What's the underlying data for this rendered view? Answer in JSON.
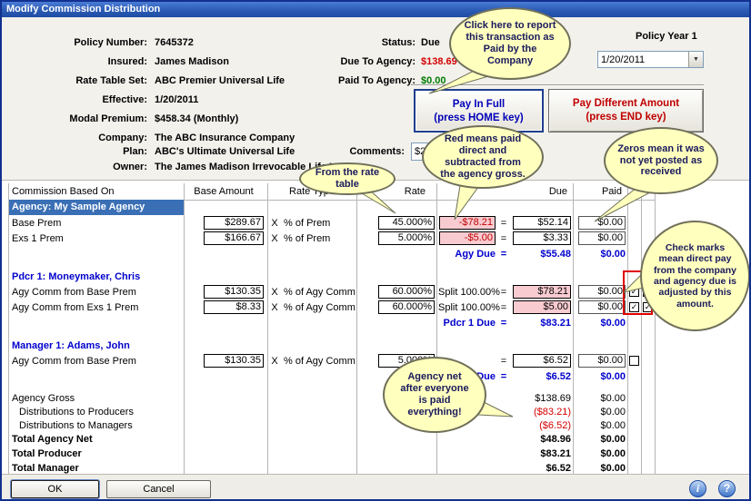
{
  "window": {
    "title": "Modify Commission Distribution"
  },
  "icons": {
    "check": "✓",
    "dropdown": "▼",
    "info": "i",
    "help": "?"
  },
  "colors": {
    "due_red": "#D40000",
    "paid_green": "#007A00",
    "sum_blue": "#0000CC",
    "pink": "#F8CBD0",
    "agency_row_blue": "#3A6FB5",
    "highlight_red": "#E00000"
  },
  "header": {
    "fields": [
      {
        "label": "Policy Number:",
        "value": "7645372"
      },
      {
        "label": "Insured:",
        "value": "James Madison"
      },
      {
        "label": "Rate Table Set:",
        "value": "ABC Premier Universal Life"
      },
      {
        "label": "Effective:",
        "value": "1/20/2011"
      },
      {
        "label": "Modal Premium:",
        "value": "$458.34 (Monthly)"
      },
      {
        "label": "Company:",
        "value": "The ABC Insurance Company"
      },
      {
        "label": "Plan:",
        "value": "ABC's Ultimate Universal Life"
      },
      {
        "label": "Owner:",
        "value": "The James Madison Irrevocable Life Ins"
      }
    ],
    "status": {
      "label": "Status:",
      "value": "Due"
    },
    "due_to_agency": {
      "label": "Due To Agency:",
      "value": "$138.69"
    },
    "paid_to_agency": {
      "label": "Paid To Agency:",
      "value": "$0.00"
    },
    "policy_year": "Policy Year 1",
    "date_value": "1/20/2011",
    "comments": {
      "label": "Comments:",
      "value": "$2"
    },
    "buttons": {
      "pay_in_full": {
        "line1": "Pay In Full",
        "line2": "(press HOME key)"
      },
      "pay_different": {
        "line1": "Pay Different Amount",
        "line2": "(press END key)"
      }
    }
  },
  "table": {
    "headers": {
      "based_on": "Commission Based On",
      "base_amount": "Base Amount",
      "rate_type": "Rate Type",
      "rate": "Rate",
      "due": "Due",
      "paid": "Paid"
    },
    "x_label": "X",
    "eq_label": "=",
    "agency": {
      "title": "Agency: My Sample Agency",
      "rows": [
        {
          "label": "Base Prem",
          "base": "$289.67",
          "rtype": "% of Prem",
          "rate": "45.000%",
          "adj": "-$78.21",
          "due": "$52.14",
          "paid": "$0.00"
        },
        {
          "label": "Exs 1 Prem",
          "base": "$166.67",
          "rtype": "% of Prem",
          "rate": "5.000%",
          "adj": "-$5.00",
          "due": "$3.33",
          "paid": "$0.00"
        }
      ],
      "due_label": "Agy Due",
      "due": "$55.48",
      "paid": "$0.00"
    },
    "producer": {
      "title": "Pdcr 1: Moneymaker, Chris",
      "rows": [
        {
          "label": "Agy Comm from Base Prem",
          "base": "$130.35",
          "rtype": "% of Agy Comm",
          "rate": "60.000%",
          "split": "Split 100.00%",
          "due": "$78.21",
          "paid": "$0.00"
        },
        {
          "label": "Agy Comm from Exs 1 Prem",
          "base": "$8.33",
          "rtype": "% of Agy Comm",
          "rate": "60.000%",
          "split": "Split 100.00%",
          "due": "$5.00",
          "paid": "$0.00"
        }
      ],
      "due_label": "Pdcr 1 Due",
      "due": "$83.21",
      "paid": "$0.00"
    },
    "manager": {
      "title": "Manager 1: Adams, John",
      "rows": [
        {
          "label": "Agy Comm from Base Prem",
          "base": "$130.35",
          "rtype": "% of Agy Comm",
          "rate": "5.000%",
          "due": "$6.52",
          "paid": "$0.00"
        }
      ],
      "due_label": "Mgr 1 Due",
      "due": "$6.52",
      "paid": "$0.00"
    },
    "summary": [
      {
        "label": "Agency Gross",
        "due": "$138.69",
        "paid": "$0.00"
      },
      {
        "label": "Distributions to Producers",
        "due": "($83.21)",
        "paid": "$0.00"
      },
      {
        "label": "Distributions to Managers",
        "due": "($6.52)",
        "paid": "$0.00"
      },
      {
        "label": "Total Agency Net",
        "due": "$48.96",
        "paid": "$0.00"
      },
      {
        "label": "Total Producer",
        "due": "$83.21",
        "paid": "$0.00"
      },
      {
        "label": "Total Manager",
        "due": "$6.52",
        "paid": "$0.00"
      }
    ]
  },
  "callouts": [
    {
      "text": "Click here to report this transaction as Paid by the Company"
    },
    {
      "text": "Red means paid direct and subtracted from the agency gross."
    },
    {
      "text": "From the rate table"
    },
    {
      "text": "Zeros mean it was not yet posted as received"
    },
    {
      "text": "Check marks mean direct pay from the company and agency due is adjusted by this amount."
    },
    {
      "text": "Agency net after everyone is paid everything!"
    }
  ],
  "footer": {
    "ok": "OK",
    "cancel": "Cancel"
  }
}
